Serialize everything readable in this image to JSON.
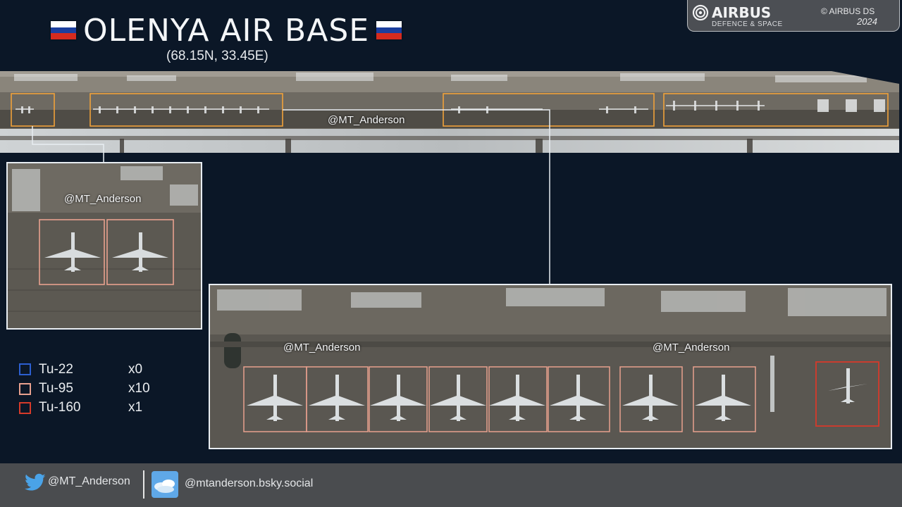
{
  "title": {
    "text": "OLENYA AIR BASE",
    "coords": "(68.15N, 33.45E)",
    "flag_colors": [
      "#ffffff",
      "#1c3f9e",
      "#d52b1e"
    ]
  },
  "credit": {
    "brand": "AIRBUS",
    "division": "DEFENCE & SPACE",
    "copyright": "© AIRBUS DS",
    "year": "2024"
  },
  "watermarks": {
    "strip": "@MT_Anderson",
    "left_panel": "@MT_Anderson",
    "main_panel_1": "@MT_Anderson",
    "main_panel_2": "@MT_Anderson"
  },
  "legend": [
    {
      "label": "Tu-22",
      "count": "x0",
      "color": "#2c5fd0"
    },
    {
      "label": "Tu-95",
      "count": "x10",
      "color": "#e8a08e"
    },
    {
      "label": "Tu-160",
      "count": "x1",
      "color": "#d63a2a"
    }
  ],
  "colors": {
    "highlight": "#f0a23a",
    "tu95_box": "#e8a08e",
    "tu160_box": "#d63a2a",
    "background": "#0b1727"
  },
  "footer": {
    "twitter_handle": "@MT_Anderson",
    "bluesky_handle": "@mtanderson.bsky.social",
    "icons": [
      "twitter-bird-icon",
      "bluesky-avatar-icon"
    ]
  }
}
